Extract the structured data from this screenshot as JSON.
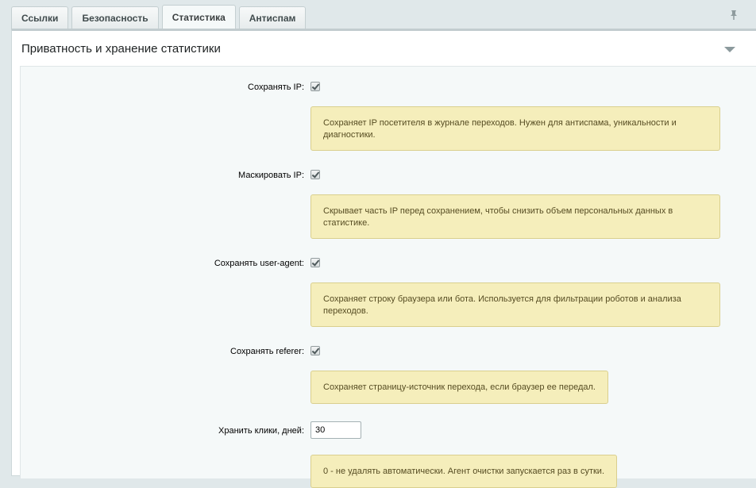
{
  "tabs": [
    {
      "label": "Ссылки",
      "active": false
    },
    {
      "label": "Безопасность",
      "active": false
    },
    {
      "label": "Статистика",
      "active": true
    },
    {
      "label": "Антиспам",
      "active": false
    }
  ],
  "section": {
    "title": "Приватность и хранение статистики"
  },
  "fields": {
    "save_ip": {
      "label": "Сохранять IP:",
      "checked": true,
      "hint": "Сохраняет IP посетителя в журнале переходов. Нужен для антиспама, уникальности и диагностики."
    },
    "mask_ip": {
      "label": "Маскировать IP:",
      "checked": true,
      "hint": "Скрывает часть IP перед сохранением, чтобы снизить объем персональных данных в статистике."
    },
    "save_user_agent": {
      "label": "Сохранять user-agent:",
      "checked": true,
      "hint": "Сохраняет строку браузера или бота. Используется для фильтрации роботов и анализа переходов."
    },
    "save_referer": {
      "label": "Сохранять referer:",
      "checked": true,
      "hint": "Сохраняет страницу-источник перехода, если браузер ее передал."
    },
    "keep_clicks_days": {
      "label": "Хранить клики, дней:",
      "value": "30",
      "hint": "0 - не удалять автоматически. Агент очистки запускается раз в сутки."
    }
  },
  "icons": {
    "pin": "pin-icon",
    "collapse": "chevron-down-icon"
  },
  "colors": {
    "hint_background": "#f5eebb",
    "hint_border": "#d9cf8e",
    "content_background": "#f5f9f9"
  }
}
